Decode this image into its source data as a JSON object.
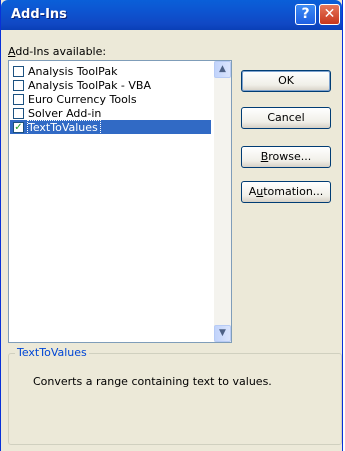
{
  "window": {
    "title": "Add-Ins",
    "help_label": "?",
    "close_label": "✕"
  },
  "addins": {
    "label_prefix": "",
    "label_accel": "A",
    "label_rest": "dd-Ins available:",
    "items": [
      {
        "label": "Analysis ToolPak",
        "checked": false,
        "mark": ""
      },
      {
        "label": "Analysis ToolPak - VBA",
        "checked": false,
        "mark": ""
      },
      {
        "label": "Euro Currency Tools",
        "checked": false,
        "mark": ""
      },
      {
        "label": "Solver Add-in",
        "checked": false,
        "mark": ""
      },
      {
        "label": "TextToValues",
        "checked": true,
        "mark": "✓"
      }
    ]
  },
  "buttons": {
    "ok": "OK",
    "cancel": "Cancel",
    "browse_accel": "B",
    "browse_rest": "rowse...",
    "automation_pre": "A",
    "automation_accel": "u",
    "automation_rest": "tomation..."
  },
  "description": {
    "title": "TextToValues",
    "text": "Converts a range containing text to values."
  },
  "colors": {
    "selection": "#316ac5",
    "titlebar": "#0d54d0",
    "group_title": "#0046d5"
  },
  "icons": {
    "help": "help-icon",
    "close": "close-icon",
    "scroll_up": "scroll-up-icon",
    "scroll_down": "scroll-down-icon"
  }
}
